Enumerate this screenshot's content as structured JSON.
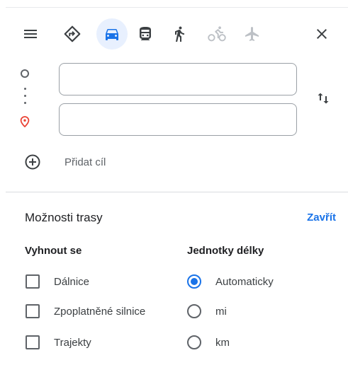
{
  "modes": [
    {
      "icon": "menu-icon"
    },
    {
      "icon": "directions-icon"
    },
    {
      "icon": "car-icon",
      "active": true
    },
    {
      "icon": "transit-icon"
    },
    {
      "icon": "walk-icon"
    },
    {
      "icon": "bicycle-icon",
      "disabled": true
    },
    {
      "icon": "flight-icon",
      "disabled": true
    },
    {
      "icon": "close-icon"
    }
  ],
  "route": {
    "origin": {
      "value": "",
      "placeholder": ""
    },
    "destination": {
      "value": "",
      "placeholder": ""
    },
    "add_destination_label": "Přidat cíl"
  },
  "options": {
    "title": "Možnosti trasy",
    "close_label": "Zavřít",
    "avoid": {
      "heading": "Vyhnout se",
      "items": [
        {
          "label": "Dálnice",
          "checked": false
        },
        {
          "label": "Zpoplatněné silnice",
          "checked": false
        },
        {
          "label": "Trajekty",
          "checked": false
        }
      ]
    },
    "units": {
      "heading": "Jednotky délky",
      "items": [
        {
          "label": "Automaticky",
          "selected": true
        },
        {
          "label": "mi",
          "selected": false
        },
        {
          "label": "km",
          "selected": false
        }
      ]
    }
  },
  "colors": {
    "accent": "#1a73e8",
    "active_mode_bg": "#e8f0fe",
    "destination_pin": "#ea4335",
    "icon": "#3c4043",
    "icon_disabled": "#bdc1c6"
  }
}
